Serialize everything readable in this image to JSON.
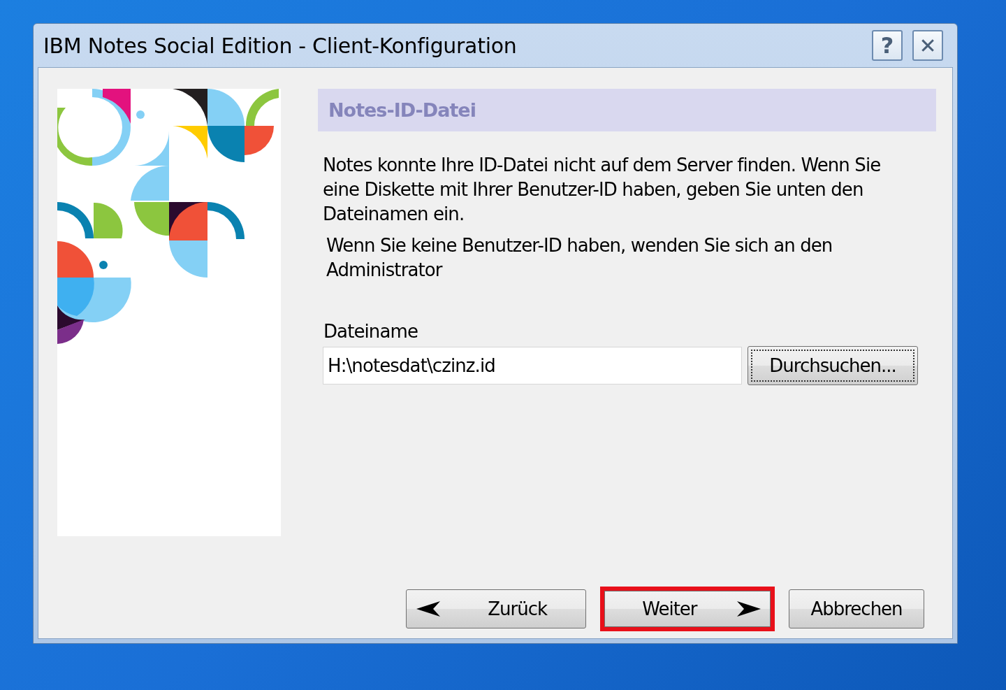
{
  "window": {
    "title": "IBM Notes Social Edition - Client-Konfiguration",
    "title_buttons": [
      "?",
      "✕"
    ]
  },
  "section": {
    "heading": "Notes-ID-Datei"
  },
  "paragraphs": [
    "Notes konnte Ihre ID-Datei nicht auf dem Server finden. Wenn Sie eine Diskette mit Ihrer Benutzer-ID haben, geben Sie unten den Dateinamen ein.",
    "Wenn Sie keine Benutzer-ID haben, wenden Sie sich an den Administrator"
  ],
  "file_field": {
    "label": "Dateiname",
    "value": "H:\\notesdat\\czinz.id",
    "browse_button": "Durchsuchen..."
  },
  "buttons": [
    {
      "label": "Zurück",
      "kind": "back",
      "highlighted": false
    },
    {
      "label": "Weiter",
      "kind": "next",
      "highlighted": true
    },
    {
      "label": "Abbrechen",
      "kind": "plain",
      "highlighted": false
    }
  ]
}
